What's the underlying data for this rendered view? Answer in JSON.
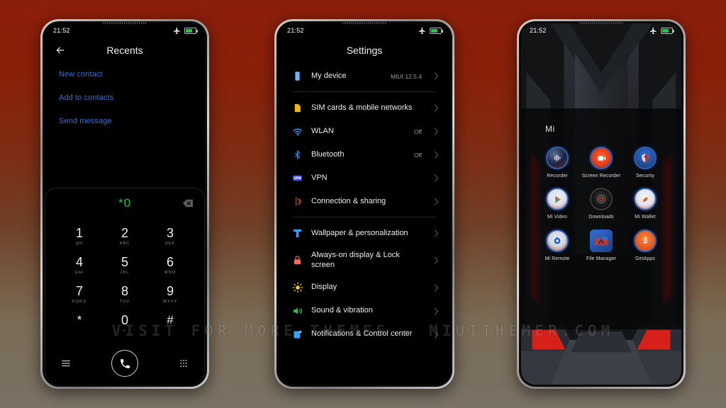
{
  "background": {
    "top_color": "#8c1e0c",
    "bottom_color": "#7a7265"
  },
  "watermark": {
    "text": "VISIT  FOR  MORE  THEMES  -  MIUITHEMER.COM"
  },
  "status_bar": {
    "time": "21:52",
    "airplane_icon": "airplane-mode-icon",
    "battery_icon": "battery-icon"
  },
  "phone1": {
    "header": {
      "back_icon": "back-arrow-icon",
      "title": "Recents"
    },
    "links": [
      {
        "label": "New contact"
      },
      {
        "label": "Add to contacts"
      },
      {
        "label": "Send message"
      }
    ],
    "dialer": {
      "number": "*0",
      "backspace_icon": "backspace-icon",
      "keys": [
        {
          "num": "1",
          "sub": "QD"
        },
        {
          "num": "2",
          "sub": "ABC"
        },
        {
          "num": "3",
          "sub": "DEF"
        },
        {
          "num": "4",
          "sub": "GHI"
        },
        {
          "num": "5",
          "sub": "JKL"
        },
        {
          "num": "6",
          "sub": "MNO"
        },
        {
          "num": "7",
          "sub": "PQRS"
        },
        {
          "num": "8",
          "sub": "TUV"
        },
        {
          "num": "9",
          "sub": "WXYZ"
        },
        {
          "num": "*",
          "sub": ""
        },
        {
          "num": "0",
          "sub": "+"
        },
        {
          "num": "#",
          "sub": ""
        }
      ],
      "menu_icon": "menu-icon",
      "call_icon": "call-icon",
      "keypad_icon": "keypad-grid-icon"
    }
  },
  "phone2": {
    "title": "Settings",
    "groups": [
      {
        "rows": [
          {
            "label": "My device",
            "value": "MIUI 12.5.4",
            "icon": "device-icon",
            "color": "#6cb6f5"
          }
        ]
      },
      {
        "rows": [
          {
            "label": "SIM cards & mobile networks",
            "value": "",
            "icon": "sim-card-icon",
            "color": "#f2b90c"
          },
          {
            "label": "WLAN",
            "value": "Off",
            "icon": "wifi-icon",
            "color": "#3aa0f0"
          },
          {
            "label": "Bluetooth",
            "value": "Off",
            "icon": "bluetooth-icon",
            "color": "#2a7ff0"
          },
          {
            "label": "VPN",
            "value": "",
            "icon": "vpn-icon",
            "color": "#4b54e8"
          },
          {
            "label": "Connection & sharing",
            "value": "",
            "icon": "connection-sharing-icon",
            "color": "#d0402a"
          }
        ]
      },
      {
        "rows": [
          {
            "label": "Wallpaper & personalization",
            "value": "",
            "icon": "wallpaper-brush-icon",
            "color": "#3aa0f0"
          },
          {
            "label": "Always-on display & Lock screen",
            "value": "",
            "icon": "lock-icon",
            "color": "#f06a5a"
          },
          {
            "label": "Display",
            "value": "",
            "icon": "brightness-icon",
            "color": "#f5c518"
          },
          {
            "label": "Sound & vibration",
            "value": "",
            "icon": "speaker-icon",
            "color": "#2bbf4e"
          },
          {
            "label": "Notifications & Control center",
            "value": "",
            "icon": "notifications-icon",
            "color": "#3aa0f0"
          }
        ]
      }
    ],
    "chevron_icon": "chevron-right-icon"
  },
  "phone3": {
    "folder_name": "Mi",
    "apps": [
      {
        "name": "Recorder",
        "icon": "recorder-icon"
      },
      {
        "name": "Screen Recorder",
        "icon": "screen-recorder-icon"
      },
      {
        "name": "Security",
        "icon": "security-shield-icon"
      },
      {
        "name": "Mi Video",
        "icon": "mi-video-icon"
      },
      {
        "name": "Downloads",
        "icon": "downloads-icon"
      },
      {
        "name": "Mi Wallet",
        "icon": "mi-wallet-icon"
      },
      {
        "name": "Mi Remote",
        "icon": "mi-remote-icon"
      },
      {
        "name": "File Manager",
        "icon": "file-manager-icon"
      },
      {
        "name": "GetApps",
        "icon": "getapps-icon"
      }
    ]
  }
}
